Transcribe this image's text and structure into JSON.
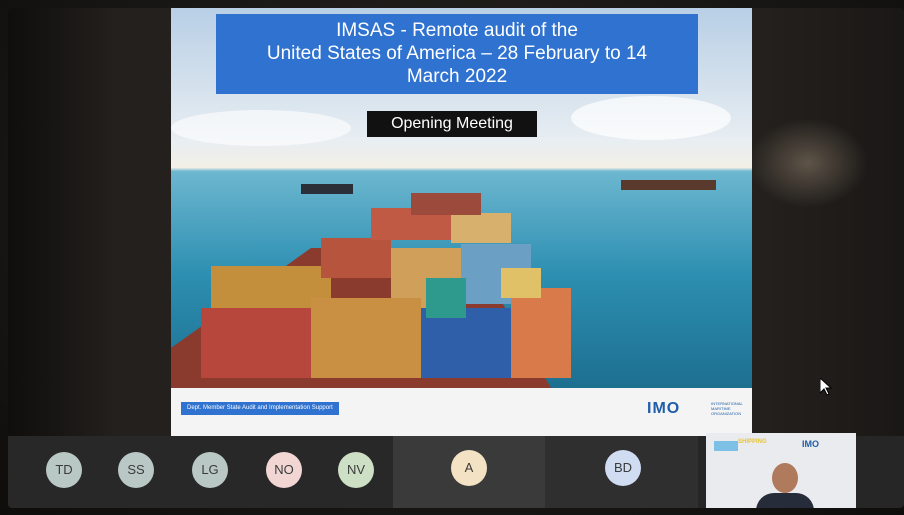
{
  "slide": {
    "title": "IMSAS - Remote audit of the United States of America – 28 February to 14 March 2022",
    "title_line1": "IMSAS - Remote audit of the",
    "title_line2": "United States of America – 28 February to 14",
    "title_line3": "March 2022",
    "subtitle": "Opening Meeting",
    "footer_label": "Dept. Member State Audit and Implementation Support",
    "logo_text": "IMO",
    "logo_subtext": "INTERNATIONAL MARITIME ORGANIZATION"
  },
  "participants": [
    {
      "initials": "TD",
      "color": "#b9c8c4"
    },
    {
      "initials": "SS",
      "color": "#b9c8c4"
    },
    {
      "initials": "LG",
      "color": "#b9c8c4"
    },
    {
      "initials": "NO",
      "color": "#f2d6d4"
    },
    {
      "initials": "NV",
      "color": "#cddfc4"
    },
    {
      "initials": "A",
      "color": "#f3e2c4"
    },
    {
      "initials": "BD",
      "color": "#cfdcf2"
    }
  ],
  "video_tile": {
    "logo_text": "IMO",
    "banner_text": "SHIPPING"
  },
  "icons": [
    "cursor-icon"
  ]
}
